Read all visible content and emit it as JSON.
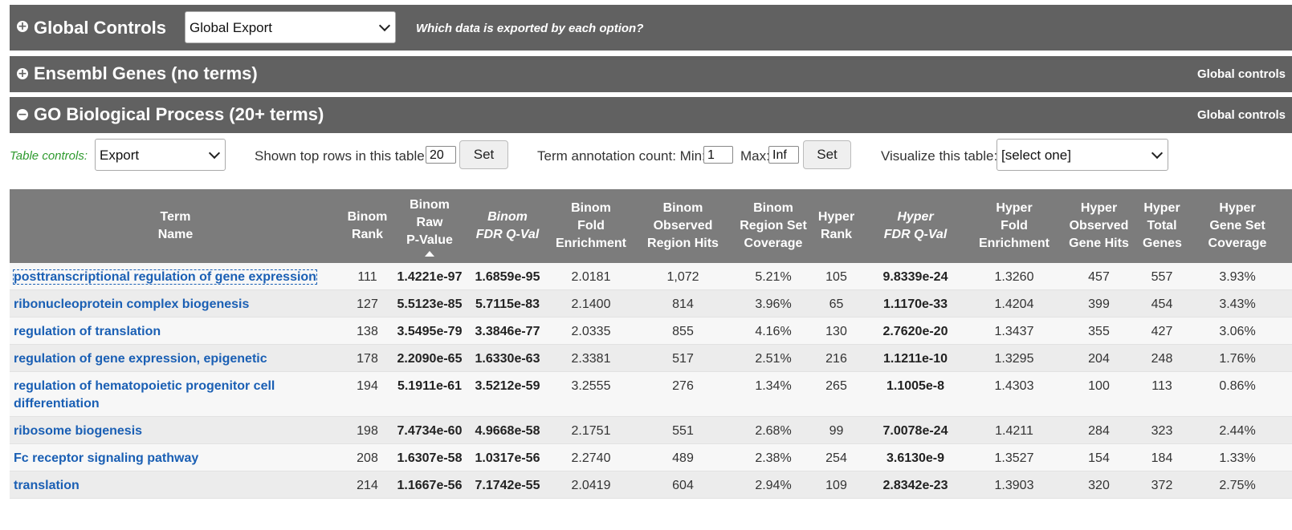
{
  "global_bar": {
    "toggle": "+",
    "title": "Global Controls",
    "select_value": "Global Export",
    "help_link": "Which data is exported by each option?"
  },
  "ensembl_bar": {
    "toggle": "+",
    "title": "Ensembl Genes (no terms)",
    "global_link": "Global controls"
  },
  "go_bar": {
    "toggle": "−",
    "title": "GO Biological Process (20+ terms)",
    "global_link": "Global controls"
  },
  "table_controls": {
    "label": "Table controls:",
    "export_select": "Export",
    "shown_rows_label": "Shown top rows in this table:",
    "shown_rows_value": "20",
    "set_label": "Set",
    "annotation_label": "Term annotation count: Min:",
    "min_value": "1",
    "max_label": "Max:",
    "max_value": "Inf",
    "visualize_label": "Visualize this table:",
    "visualize_select": "[select one]"
  },
  "columns": [
    [
      "Term",
      "Name"
    ],
    [
      "Binom",
      "Rank"
    ],
    [
      "Binom",
      "Raw",
      "P-Value"
    ],
    [
      "Binom",
      "FDR Q-Val"
    ],
    [
      "Binom",
      "Fold",
      "Enrichment"
    ],
    [
      "Binom",
      "Observed",
      "Region Hits"
    ],
    [
      "Binom",
      "Region Set",
      "Coverage"
    ],
    [
      "Hyper",
      "Rank"
    ],
    [
      "Hyper",
      "FDR Q-Val"
    ],
    [
      "Hyper",
      "Fold",
      "Enrichment"
    ],
    [
      "Hyper",
      "Observed",
      "Gene Hits"
    ],
    [
      "Hyper",
      "Total",
      "Genes"
    ],
    [
      "Hyper",
      "Gene Set",
      "Coverage"
    ]
  ],
  "rows": [
    [
      "posttranscriptional regulation of gene expression",
      "111",
      "1.4221e-97",
      "1.6859e-95",
      "2.0181",
      "1,072",
      "5.21%",
      "105",
      "9.8339e-24",
      "1.3260",
      "457",
      "557",
      "3.93%"
    ],
    [
      "ribonucleoprotein complex biogenesis",
      "127",
      "5.5123e-85",
      "5.7115e-83",
      "2.1400",
      "814",
      "3.96%",
      "65",
      "1.1170e-33",
      "1.4204",
      "399",
      "454",
      "3.43%"
    ],
    [
      "regulation of translation",
      "138",
      "3.5495e-79",
      "3.3846e-77",
      "2.0335",
      "855",
      "4.16%",
      "130",
      "2.7620e-20",
      "1.3437",
      "355",
      "427",
      "3.06%"
    ],
    [
      "regulation of gene expression, epigenetic",
      "178",
      "2.2090e-65",
      "1.6330e-63",
      "2.3381",
      "517",
      "2.51%",
      "216",
      "1.1211e-10",
      "1.3295",
      "204",
      "248",
      "1.76%"
    ],
    [
      "regulation of hematopoietic progenitor cell differentiation",
      "194",
      "5.1911e-61",
      "3.5212e-59",
      "3.2555",
      "276",
      "1.34%",
      "265",
      "1.1005e-8",
      "1.4303",
      "100",
      "113",
      "0.86%"
    ],
    [
      "ribosome biogenesis",
      "198",
      "7.4734e-60",
      "4.9668e-58",
      "2.1751",
      "551",
      "2.68%",
      "99",
      "7.0078e-24",
      "1.4211",
      "284",
      "323",
      "2.44%"
    ],
    [
      "Fc receptor signaling pathway",
      "208",
      "1.6307e-58",
      "1.0317e-56",
      "2.2740",
      "489",
      "2.38%",
      "254",
      "3.6130e-9",
      "1.3527",
      "154",
      "184",
      "1.33%"
    ],
    [
      "translation",
      "214",
      "1.1667e-56",
      "7.1742e-55",
      "2.0419",
      "604",
      "2.94%",
      "109",
      "2.8342e-23",
      "1.3903",
      "320",
      "372",
      "2.75%"
    ]
  ]
}
